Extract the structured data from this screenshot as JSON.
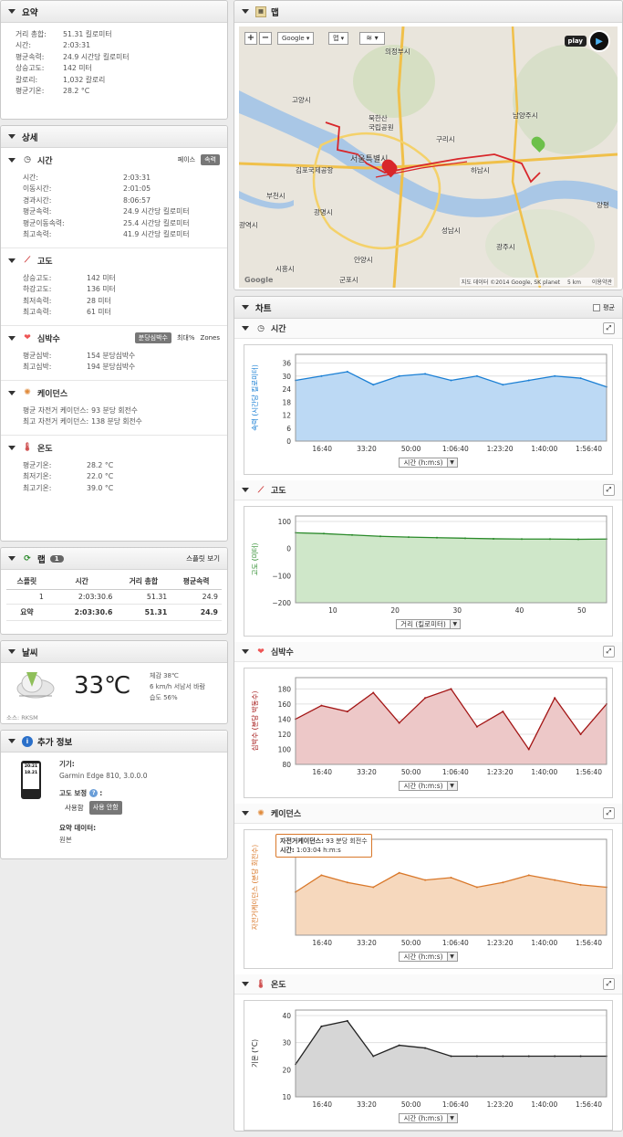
{
  "summary": {
    "title": "요약",
    "rows": [
      {
        "k": "거리 총합:",
        "v": "51.31 킬로미터"
      },
      {
        "k": "시간:",
        "v": "2:03:31"
      },
      {
        "k": "평균속력:",
        "v": "24.9 시간당 킬로미터"
      },
      {
        "k": "상승고도:",
        "v": "142 미터"
      },
      {
        "k": "칼로리:",
        "v": "1,032 칼로리"
      },
      {
        "k": "평균기온:",
        "v": "28.2 °C"
      }
    ]
  },
  "detail": {
    "title": "상세",
    "time": {
      "title": "시간",
      "opt1": "페이스",
      "opt2": "속력",
      "rows": [
        {
          "k": "시간:",
          "v": "2:03:31"
        },
        {
          "k": "이동시간:",
          "v": "2:01:05"
        },
        {
          "k": "경과시간:",
          "v": "8:06:57"
        },
        {
          "k": "평균속력:",
          "v": "24.9 시간당 킬로미터"
        },
        {
          "k": "평균이동속력:",
          "v": "25.4 시간당 킬로미터"
        },
        {
          "k": "최고속력:",
          "v": "41.9 시간당 킬로미터"
        }
      ]
    },
    "elev": {
      "title": "고도",
      "rows": [
        {
          "k": "상승고도:",
          "v": "142 미터"
        },
        {
          "k": "하강고도:",
          "v": "136 미터"
        },
        {
          "k": "최저속력:",
          "v": "28 미터"
        },
        {
          "k": "최고속력:",
          "v": "61 미터"
        }
      ]
    },
    "hr": {
      "title": "심박수",
      "opt1": "분당심박수",
      "opt2": "최대%",
      "opt3": "Zones",
      "rows": [
        {
          "k": "평균심박:",
          "v": "154 분당심박수"
        },
        {
          "k": "최고심박:",
          "v": "194 분당심박수"
        }
      ]
    },
    "cad": {
      "title": "케이던스",
      "rows": [
        {
          "k": "평균 자전거 케이던스:",
          "v": "93 분당 회전수"
        },
        {
          "k": "최고 자전거 케이던스:",
          "v": "138 분당 회전수"
        }
      ]
    },
    "temp": {
      "title": "온도",
      "rows": [
        {
          "k": "평균기온:",
          "v": "28.2 °C"
        },
        {
          "k": "최저기온:",
          "v": "22.0 °C"
        },
        {
          "k": "최고기온:",
          "v": "39.0 °C"
        }
      ]
    }
  },
  "laps": {
    "title": "랩",
    "count": "1",
    "view": "스플릿 보기",
    "headers": [
      "스플릿",
      "시간",
      "거리 총합",
      "평균속력"
    ],
    "row": [
      "1",
      "2:03:30.6",
      "51.31",
      "24.9"
    ],
    "total": [
      "요약",
      "2:03:30.6",
      "51.31",
      "24.9"
    ]
  },
  "weather": {
    "title": "날씨",
    "temp": "33",
    "unit": "℃",
    "feel": "체감 38℃",
    "wind": "6 km/h 서남서 바람",
    "hum": "습도 56%",
    "source": "소스: RKSM"
  },
  "extra": {
    "title": "추가 정보",
    "device_label": "기기:",
    "device": "Garmin Edge 810, 3.0.0.0",
    "elev_label": "고도 보정",
    "opt1": "사용함",
    "opt2": "사용 안함",
    "data_label": "요약 데이터:",
    "data": "원본",
    "screen1": "20:21",
    "screen2": "18.21"
  },
  "map": {
    "title": "맵",
    "google": "Google",
    "maptype": "맵",
    "play": "play",
    "credit": "지도 데이터 ©2014 Google, SK planet",
    "scale": "5 km",
    "terms": "이용약관",
    "labels": [
      "의정부시",
      "남양주시",
      "고양시",
      "북한산",
      "국립공원",
      "구리시",
      "서울특별시",
      "김포국제공항",
      "하남시",
      "부천시",
      "광명시",
      "성남시",
      "광주시",
      "안양시",
      "시흥시",
      "군포시",
      "양평",
      "광역시"
    ]
  },
  "charts": {
    "title": "차트",
    "avg": "평균",
    "colors": {
      "speed": "#1a7fd4",
      "elev": "#2a8a2a",
      "hr": "#a31515",
      "cad": "#d9782a",
      "temp": "#222222"
    },
    "speed": {
      "title": "시간",
      "ylabel": "속력 (시간당 킬로미터)",
      "yticks": [
        "36",
        "30",
        "24",
        "18",
        "12",
        "6",
        "0"
      ],
      "xticks": [
        "16:40",
        "33:20",
        "50:00",
        "1:06:40",
        "1:23:20",
        "1:40:00",
        "1:56:40"
      ],
      "xsel": "시간 (h:m:s)"
    },
    "elev": {
      "title": "고도",
      "ylabel": "고도 (미터)",
      "yticks": [
        "100",
        "0",
        "−100",
        "−200"
      ],
      "xticks": [
        "10",
        "20",
        "30",
        "40",
        "50"
      ],
      "xsel": "거리 (킬로미터)"
    },
    "hr": {
      "title": "심박수",
      "ylabel": "심박수 (분당 박동수)",
      "yticks": [
        "180",
        "160",
        "140",
        "120",
        "100",
        "80"
      ],
      "xticks": [
        "16:40",
        "33:20",
        "50:00",
        "1:06:40",
        "1:23:20",
        "1:40:00",
        "1:56:40"
      ],
      "xsel": "시간 (h:m:s)"
    },
    "cad": {
      "title": "케이던스",
      "ylabel": "자전거케이던스 (분당 회전수)",
      "xticks": [
        "16:40",
        "33:20",
        "50:00",
        "1:06:40",
        "1:23:20",
        "1:40:00",
        "1:56:40"
      ],
      "xsel": "시간 (h:m:s)",
      "tip1": "자전거케이던스:",
      "tip1v": "93 분당 회전수",
      "tip2": "시간:",
      "tip2v": "1:03:04 h:m:s"
    },
    "temp": {
      "title": "온도",
      "ylabel": "기온 (°C)",
      "yticks": [
        "40",
        "30",
        "20",
        "10"
      ],
      "xticks": [
        "16:40",
        "33:20",
        "50:00",
        "1:06:40",
        "1:23:20",
        "1:40:00",
        "1:56:40"
      ],
      "xsel": "시간 (h:m:s)"
    }
  },
  "chart_data": [
    {
      "type": "area",
      "title": "시간",
      "ylabel": "속력 (시간당 킬로미터)",
      "xlabel": "시간 (h:m:s)",
      "ylim": [
        0,
        40
      ],
      "x": [
        "0:00",
        "10:00",
        "20:00",
        "30:00",
        "40:00",
        "50:00",
        "1:00:00",
        "1:10:00",
        "1:20:00",
        "1:30:00",
        "1:40:00",
        "1:50:00",
        "2:00:00"
      ],
      "values": [
        28,
        30,
        32,
        26,
        30,
        31,
        28,
        30,
        26,
        28,
        30,
        29,
        25
      ]
    },
    {
      "type": "area",
      "title": "고도",
      "ylabel": "고도 (미터)",
      "xlabel": "거리 (킬로미터)",
      "ylim": [
        -200,
        120
      ],
      "x": [
        0,
        5,
        10,
        15,
        20,
        25,
        30,
        35,
        40,
        45,
        50,
        52
      ],
      "values": [
        58,
        55,
        50,
        45,
        42,
        40,
        38,
        36,
        35,
        35,
        34,
        35
      ]
    },
    {
      "type": "area",
      "title": "심박수",
      "ylabel": "심박수 (분당 박동수)",
      "xlabel": "시간 (h:m:s)",
      "ylim": [
        80,
        195
      ],
      "x": [
        "0:00",
        "10:00",
        "20:00",
        "30:00",
        "40:00",
        "50:00",
        "1:00:00",
        "1:10:00",
        "1:20:00",
        "1:30:00",
        "1:40:00",
        "1:50:00",
        "2:00:00"
      ],
      "values": [
        140,
        158,
        150,
        175,
        135,
        168,
        180,
        130,
        150,
        100,
        168,
        120,
        160
      ]
    },
    {
      "type": "area",
      "title": "케이던스",
      "ylabel": "자전거케이던스 (분당 회전수)",
      "xlabel": "시간 (h:m:s)",
      "x": [
        "0:00",
        "10:00",
        "20:00",
        "30:00",
        "40:00",
        "50:00",
        "1:00:00",
        "1:10:00",
        "1:20:00",
        "1:30:00",
        "1:40:00",
        "1:50:00",
        "2:00:00"
      ],
      "values": [
        88,
        95,
        92,
        90,
        96,
        93,
        94,
        90,
        92,
        95,
        93,
        91,
        90
      ]
    },
    {
      "type": "area",
      "title": "온도",
      "ylabel": "기온 (°C)",
      "xlabel": "시간 (h:m:s)",
      "ylim": [
        10,
        42
      ],
      "x": [
        "0:00",
        "10:00",
        "20:00",
        "30:00",
        "40:00",
        "50:00",
        "1:00:00",
        "1:10:00",
        "1:20:00",
        "1:30:00",
        "1:40:00",
        "1:50:00",
        "2:00:00"
      ],
      "values": [
        22,
        36,
        38,
        25,
        29,
        28,
        25,
        25,
        25,
        25,
        25,
        25,
        25
      ]
    }
  ]
}
